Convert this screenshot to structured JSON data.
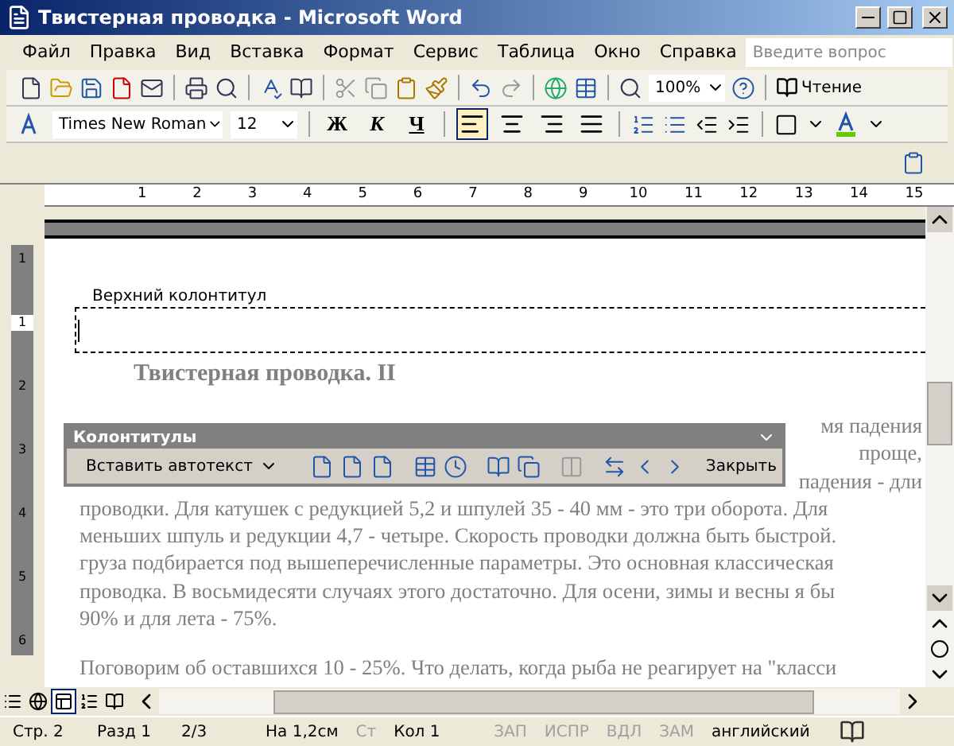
{
  "window": {
    "title": "Твистерная проводка - Microsoft Word"
  },
  "menu": [
    "Файл",
    "Правка",
    "Вид",
    "Вставка",
    "Формат",
    "Сервис",
    "Таблица",
    "Окно",
    "Справка"
  ],
  "help_search": {
    "placeholder": "Введите вопрос"
  },
  "standard_toolbar": {
    "zoom": "100%",
    "reading": "Чтение"
  },
  "formatting_toolbar": {
    "font": "Times New Roman",
    "size": "12",
    "styles": [
      "Ж",
      "К",
      "Ч"
    ],
    "align": [
      {
        "kind": "left",
        "selected": true
      },
      {
        "kind": "center",
        "selected": false
      },
      {
        "kind": "right",
        "selected": false
      },
      {
        "kind": "justify",
        "selected": false
      }
    ]
  },
  "ruler": {
    "numbers": [
      "1",
      "2",
      "3",
      "4",
      "5",
      "6",
      "7",
      "8",
      "9",
      "10",
      "11",
      "12",
      "13",
      "14",
      "15"
    ],
    "vertical_numbers": [
      "1",
      "1",
      "2",
      "3",
      "4",
      "5",
      "6"
    ]
  },
  "document": {
    "header_label": "Верхний колонтитул",
    "title": "Твистерная проводка. II",
    "covered_lines": [
      "мя падения",
      "проще,",
      "падения - дли"
    ],
    "lines": [
      "проводки. Для катушек с редукцией 5,2 и шпулей 35 - 40 мм - это три оборота. Для",
      "меньших шпуль и редукции 4,7 - четыре. Скорость проводки должна быть быстрой.",
      "груза подбирается под вышеперечисленные параметры. Это основная классическая",
      "проводка. В восьмидесяти случаях этого достаточно. Для осени, зимы и весны я бы",
      "90% и для лета - 75%."
    ],
    "last_line": "Поговорим об оставшихся 10 - 25%. Что делать, когда рыба не реагирует на \"класси"
  },
  "header_toolbar": {
    "title": "Колонтитулы",
    "autotext": "Вставить автотекст",
    "close": "Закрыть"
  },
  "views": [
    {
      "kind": "normal",
      "selected": false
    },
    {
      "kind": "web",
      "selected": false
    },
    {
      "kind": "print",
      "selected": true
    },
    {
      "kind": "outline",
      "selected": false
    },
    {
      "kind": "reading",
      "selected": false
    }
  ],
  "status_bar": [
    {
      "text": "Стр. 2",
      "disabled": false
    },
    {
      "text": "Разд 1",
      "disabled": false
    },
    {
      "text": "2/3",
      "disabled": false
    },
    {
      "text": "На 1,2см",
      "disabled": false
    },
    {
      "text": "Ст",
      "disabled": true
    },
    {
      "text": "Кол 1",
      "disabled": false
    },
    {
      "text": "ЗАП",
      "disabled": true
    },
    {
      "text": "ИСПР",
      "disabled": true
    },
    {
      "text": "ВДЛ",
      "disabled": true
    },
    {
      "text": "ЗАМ",
      "disabled": true
    },
    {
      "text": "английский",
      "disabled": false
    }
  ]
}
